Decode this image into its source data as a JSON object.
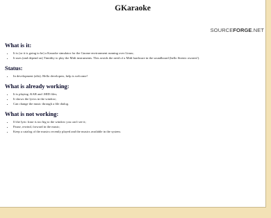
{
  "page": {
    "title": "GKaraoke",
    "logo_light": "SOURCE",
    "logo_bold": "FORGE",
    "logo_tail": ".NET"
  },
  "sections": [
    {
      "heading": "What is it:",
      "items": [
        "It is (or it is going to be) a Karaoke simulator for the Gnome environment running over Linux;",
        "It uses (and depend on) Timidity to play the Midi instruments. This avoids the need of a Midi hardware in the soundboard (hello Sirenic owners!)."
      ]
    },
    {
      "heading": "Status:",
      "items": [
        "In development (alfa). Hello developers, help is welcome!"
      ]
    },
    {
      "heading": "What is already working:",
      "items": [
        "It is playing .KAR and .MID files;",
        "It shows the lyrics in the window;",
        "Can change the music through a file dialog."
      ]
    },
    {
      "heading": "What is not working:",
      "items": [
        "If the lyric frase is too big to the window you can't see it;",
        "Pause, rewind, forward in the music;",
        "Keep a catalog of the musics recently played and the musics available in the system."
      ]
    }
  ]
}
